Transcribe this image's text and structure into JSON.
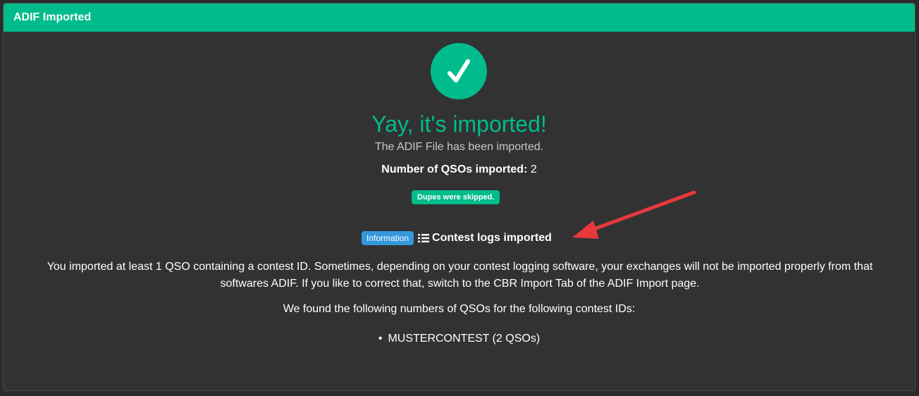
{
  "header": {
    "title": "ADIF Imported"
  },
  "success": {
    "icon": "checkmark-icon",
    "headline": "Yay, it's imported!",
    "subline": "The ADIF File has been imported.",
    "count_label": "Number of QSOs imported:",
    "count_value": " 2",
    "dupes_badge": "Dupes were skipped."
  },
  "contest_info": {
    "badge": "Information",
    "icon": "list-icon",
    "title": "Contest logs imported",
    "paragraph": "You imported at least 1 QSO containing a contest ID. Sometimes, depending on your contest logging software, your exchanges will not be imported properly from that softwares ADIF. If you like to correct that, switch to the CBR Import Tab of the ADIF Import page.",
    "found_line": "We found the following numbers of QSOs for the following contest IDs:",
    "contests": [
      {
        "label": "MUSTERCONTEST (2 QSOs)"
      }
    ]
  },
  "colors": {
    "accent": "#00bc8c",
    "info": "#3498db",
    "annotation_arrow": "#e8383d",
    "panel_bg": "#323232"
  }
}
